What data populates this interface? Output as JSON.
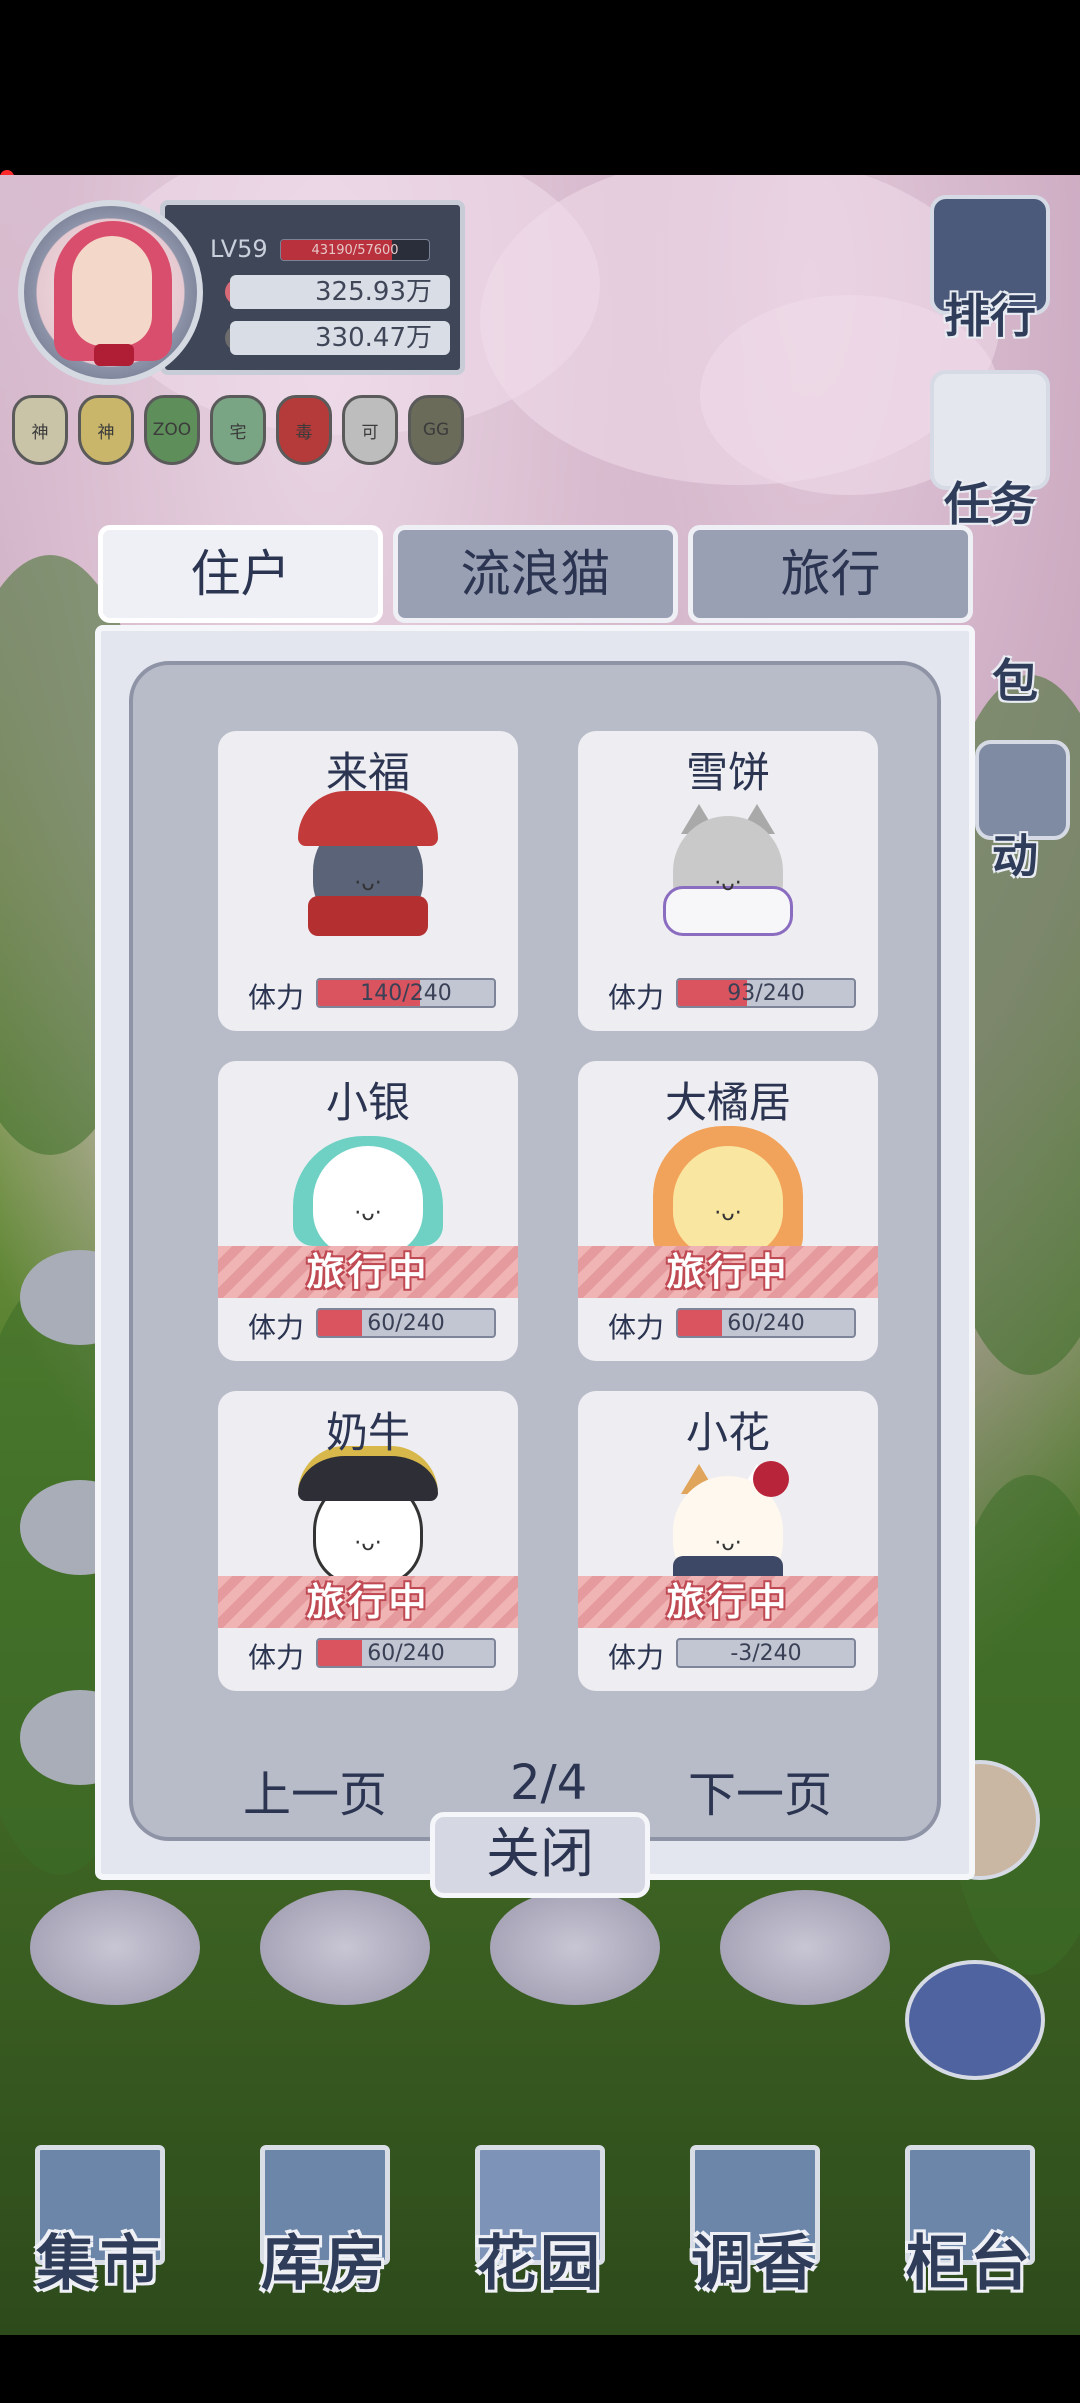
{
  "player": {
    "level": "LV59",
    "exp": "43190/57600",
    "exp_fraction": 0.75,
    "currency1": "325.93万",
    "currency2": "330.47万"
  },
  "badges": [
    "神",
    "神",
    "ZOO",
    "宅",
    "毒",
    "可",
    "GG"
  ],
  "badge_colors": [
    "#c9c4a8",
    "#c9b66a",
    "#5e8f5a",
    "#7aa585",
    "#b53a3a",
    "#bdbdbd",
    "#6b6b5a"
  ],
  "side_menu": {
    "rank": "排行",
    "task": "任务",
    "bag": "包",
    "event": "动"
  },
  "tabs": [
    "住户",
    "流浪猫",
    "旅行"
  ],
  "residents": [
    {
      "name": "来福",
      "stamina": "140/240",
      "stamina_fraction": 0.58,
      "status": ""
    },
    {
      "name": "雪饼",
      "stamina": "93/240",
      "stamina_fraction": 0.39,
      "status": ""
    },
    {
      "name": "小银",
      "stamina": "60/240",
      "stamina_fraction": 0.25,
      "status": "旅行中"
    },
    {
      "name": "大橘居",
      "stamina": "60/240",
      "stamina_fraction": 0.25,
      "status": "旅行中"
    },
    {
      "name": "奶牛",
      "stamina": "60/240",
      "stamina_fraction": 0.25,
      "status": "旅行中"
    },
    {
      "name": "小花",
      "stamina": "-3/240",
      "stamina_fraction": 0,
      "status": "旅行中"
    }
  ],
  "stamina_label": "体力",
  "pager": {
    "prev": "上一页",
    "page": "2/4",
    "next": "下一页"
  },
  "close_label": "关闭",
  "bottom_nav": [
    "集市",
    "库房",
    "花园",
    "调香",
    "柜台"
  ],
  "colors": {
    "accent_navy": "#2b3450",
    "stamina_red": "#d9545f",
    "traveling_pink": "#f0b4b4"
  }
}
